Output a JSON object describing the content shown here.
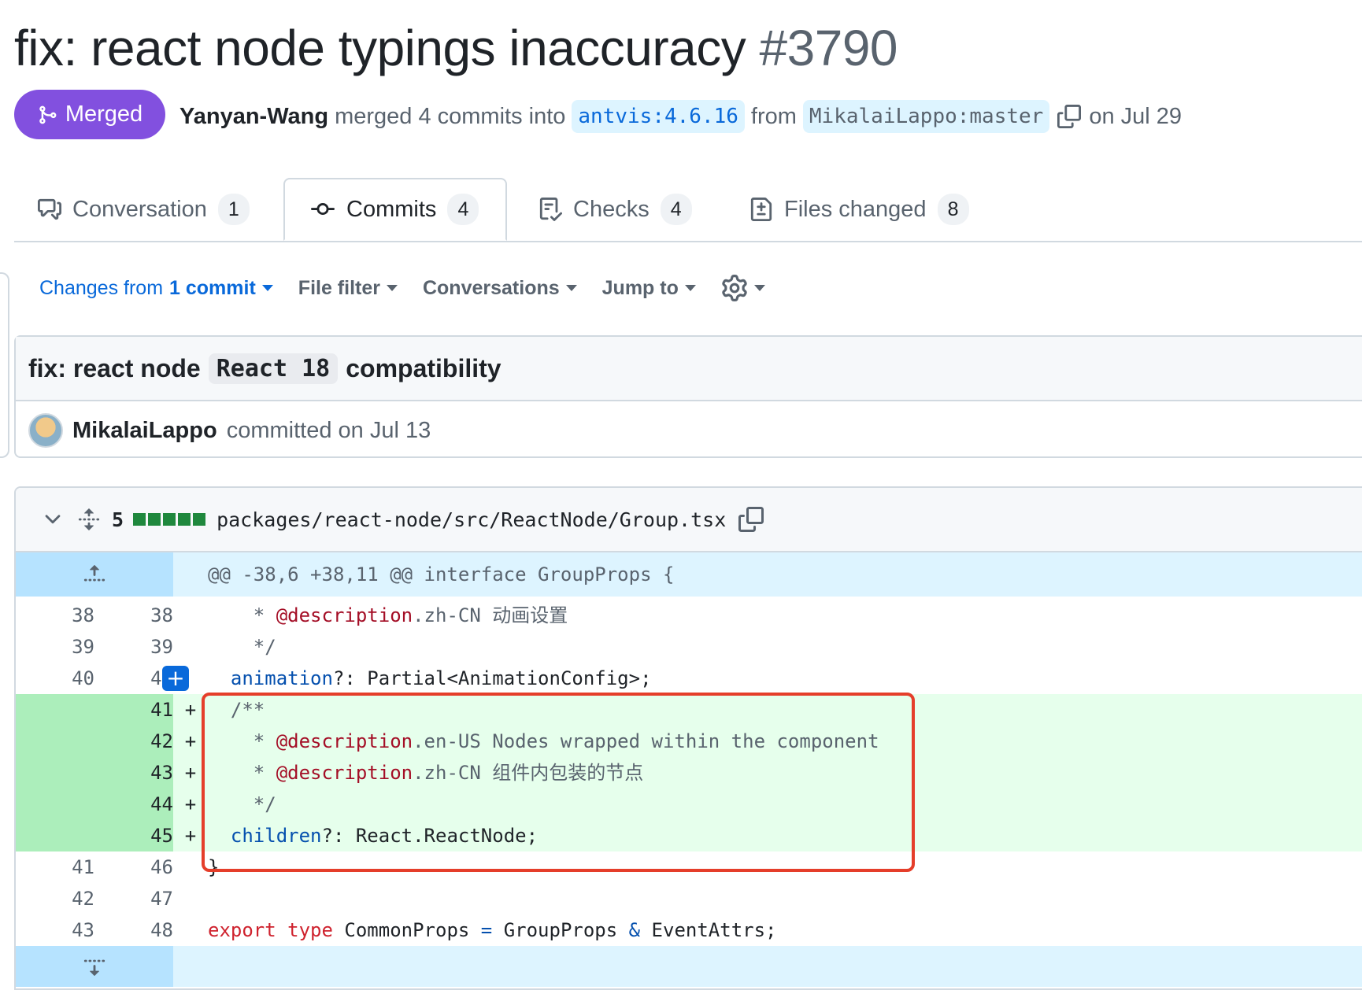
{
  "pr": {
    "title": "fix: react node typings inaccuracy",
    "number": "#3790",
    "state": "Merged",
    "author": "Yanyan-Wang",
    "merged_text": "merged 4 commits into",
    "base_branch": "antvis:4.6.16",
    "from_text": "from",
    "head_branch": "MikalaiLappo:master",
    "date_text": "on Jul 29"
  },
  "tabs": [
    {
      "label": "Conversation",
      "count": "1"
    },
    {
      "label": "Commits",
      "count": "4"
    },
    {
      "label": "Checks",
      "count": "4"
    },
    {
      "label": "Files changed",
      "count": "8"
    }
  ],
  "toolbar": {
    "changes_prefix": "Changes from",
    "changes_bold": "1 commit",
    "file_filter": "File filter",
    "conversations": "Conversations",
    "jump_to": "Jump to"
  },
  "commit": {
    "title_pre": "fix: react node",
    "title_code": "React 18",
    "title_post": "compatibility",
    "author": "MikalaiLappo",
    "committed_text": "committed on Jul 13"
  },
  "file": {
    "changes": "5",
    "path": "packages/react-node/src/ReactNode/Group.tsx",
    "hunk_header": "@@ -38,6 +38,11 @@ interface GroupProps {"
  },
  "lines": [
    {
      "old": "38",
      "new": "38",
      "sign": "",
      "parts": [
        [
          "cm",
          "    * "
        ],
        [
          "dec",
          "@description"
        ],
        [
          "cm",
          ".zh-CN 动画设置"
        ]
      ]
    },
    {
      "old": "39",
      "new": "39",
      "sign": "",
      "parts": [
        [
          "cm",
          "    */"
        ]
      ]
    },
    {
      "old": "40",
      "new": "40",
      "sign": "",
      "parts": [
        [
          "prop",
          "  animation"
        ],
        [
          "",
          "?: Partial<AnimationConfig>;"
        ]
      ]
    },
    {
      "old": "",
      "new": "41",
      "sign": "+",
      "parts": [
        [
          "cm",
          "  /**"
        ]
      ]
    },
    {
      "old": "",
      "new": "42",
      "sign": "+",
      "parts": [
        [
          "cm",
          "    * "
        ],
        [
          "dec",
          "@description"
        ],
        [
          "cm",
          ".en-US Nodes wrapped within the component"
        ]
      ]
    },
    {
      "old": "",
      "new": "43",
      "sign": "+",
      "parts": [
        [
          "cm",
          "    * "
        ],
        [
          "dec",
          "@description"
        ],
        [
          "cm",
          ".zh-CN 组件内包装的节点"
        ]
      ]
    },
    {
      "old": "",
      "new": "44",
      "sign": "+",
      "parts": [
        [
          "cm",
          "    */"
        ]
      ]
    },
    {
      "old": "",
      "new": "45",
      "sign": "+",
      "parts": [
        [
          "prop",
          "  children"
        ],
        [
          "",
          "?: React.ReactNode;"
        ]
      ]
    },
    {
      "old": "41",
      "new": "46",
      "sign": "",
      "parts": [
        [
          "",
          "}"
        ]
      ]
    },
    {
      "old": "42",
      "new": "47",
      "sign": "",
      "parts": [
        [
          "",
          ""
        ]
      ]
    },
    {
      "old": "43",
      "new": "48",
      "sign": "",
      "parts": [
        [
          "kw",
          "export"
        ],
        [
          "",
          " "
        ],
        [
          "kw",
          "type"
        ],
        [
          "",
          " CommonProps "
        ],
        [
          "prop",
          "="
        ],
        [
          "",
          " GroupProps "
        ],
        [
          "prop",
          "&"
        ],
        [
          "",
          " EventAttrs;"
        ]
      ]
    }
  ],
  "colors": {
    "merged": "#8250df",
    "link": "#0969da",
    "add_bg": "#e6ffec",
    "hunk_bg": "#ddf4ff",
    "highlight": "#e53e2a"
  }
}
